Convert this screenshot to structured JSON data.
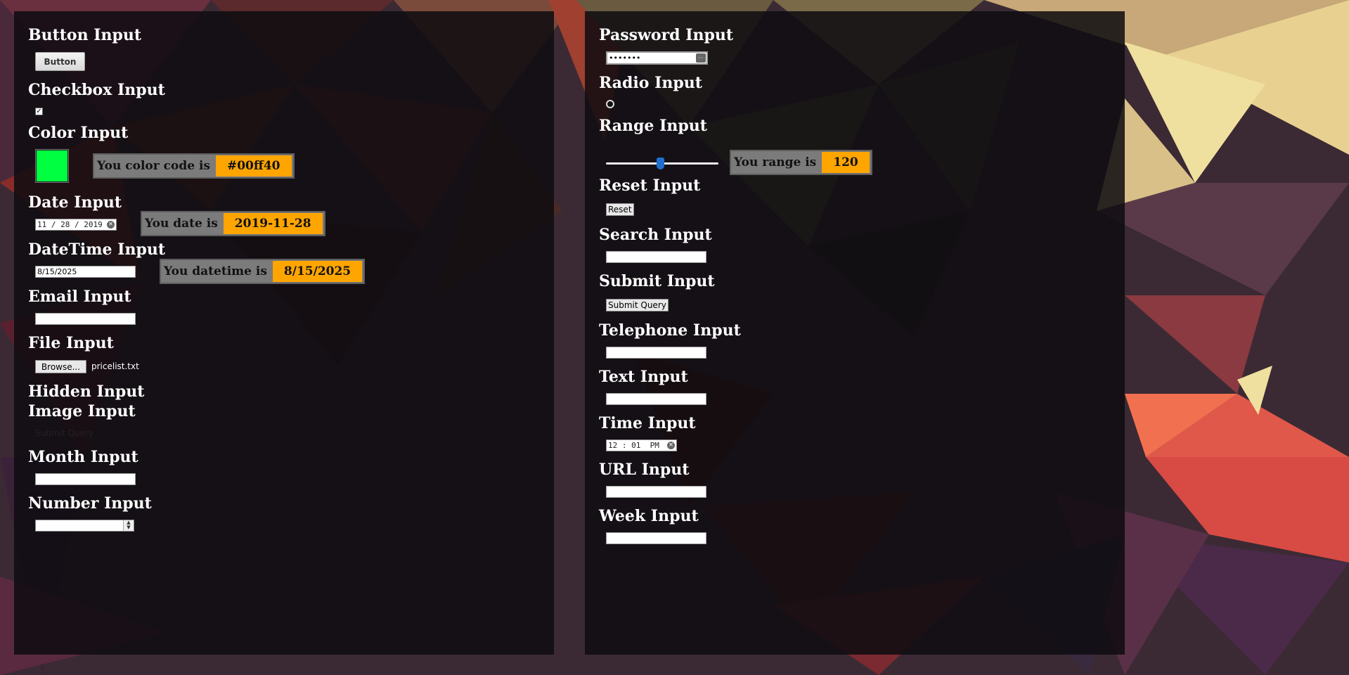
{
  "left_panel": {
    "button_heading": "Button Input",
    "button_label": "Button",
    "checkbox_heading": "Checkbox Input",
    "checkbox_glyph": "✓",
    "color_heading": "Color Input",
    "color_value": "#00ff40",
    "color_result_label": "You color code is",
    "color_result_value": "#00ff40",
    "date_heading": "Date Input",
    "date_field_value": "11 / 28 / 2019",
    "date_result_label": "You date is",
    "date_result_value": "2019-11-28",
    "datetime_heading": "DateTime Input",
    "datetime_field_value": "8/15/2025",
    "datetime_result_label": "You datetime is",
    "datetime_result_value": "8/15/2025",
    "email_heading": "Email Input",
    "file_heading": "File Input",
    "file_button_label": "Browse...",
    "file_name": "pricelist.txt",
    "hidden_heading": "Hidden Input",
    "image_heading": "Image Input",
    "image_alt": "Submit Query",
    "month_heading": "Month Input",
    "number_heading": "Number Input"
  },
  "right_panel": {
    "password_heading": "Password Input",
    "password_value": "•••••••",
    "radio_heading": "Radio Input",
    "range_heading": "Range Input",
    "range_value": 120,
    "range_min": 0,
    "range_max": 250,
    "range_result_label": "You range is",
    "range_result_value": "120",
    "reset_heading": "Reset Input",
    "reset_label": "Reset",
    "search_heading": "Search Input",
    "submit_heading": "Submit Input",
    "submit_label": "Submit Query",
    "telephone_heading": "Telephone Input",
    "text_heading": "Text Input",
    "time_heading": "Time Input",
    "time_value": "12 : 01  PM",
    "url_heading": "URL Input",
    "week_heading": "Week Input"
  },
  "colors": {
    "accent_orange": "#ffa500",
    "result_grey": "#7b7b7b",
    "panel_bg": "#0e0c10",
    "range_thumb": "#1f6fd0"
  },
  "icons": {
    "clear": "clear-icon",
    "keyboard": "keyboard-icon",
    "spin": "spinner-icon"
  }
}
